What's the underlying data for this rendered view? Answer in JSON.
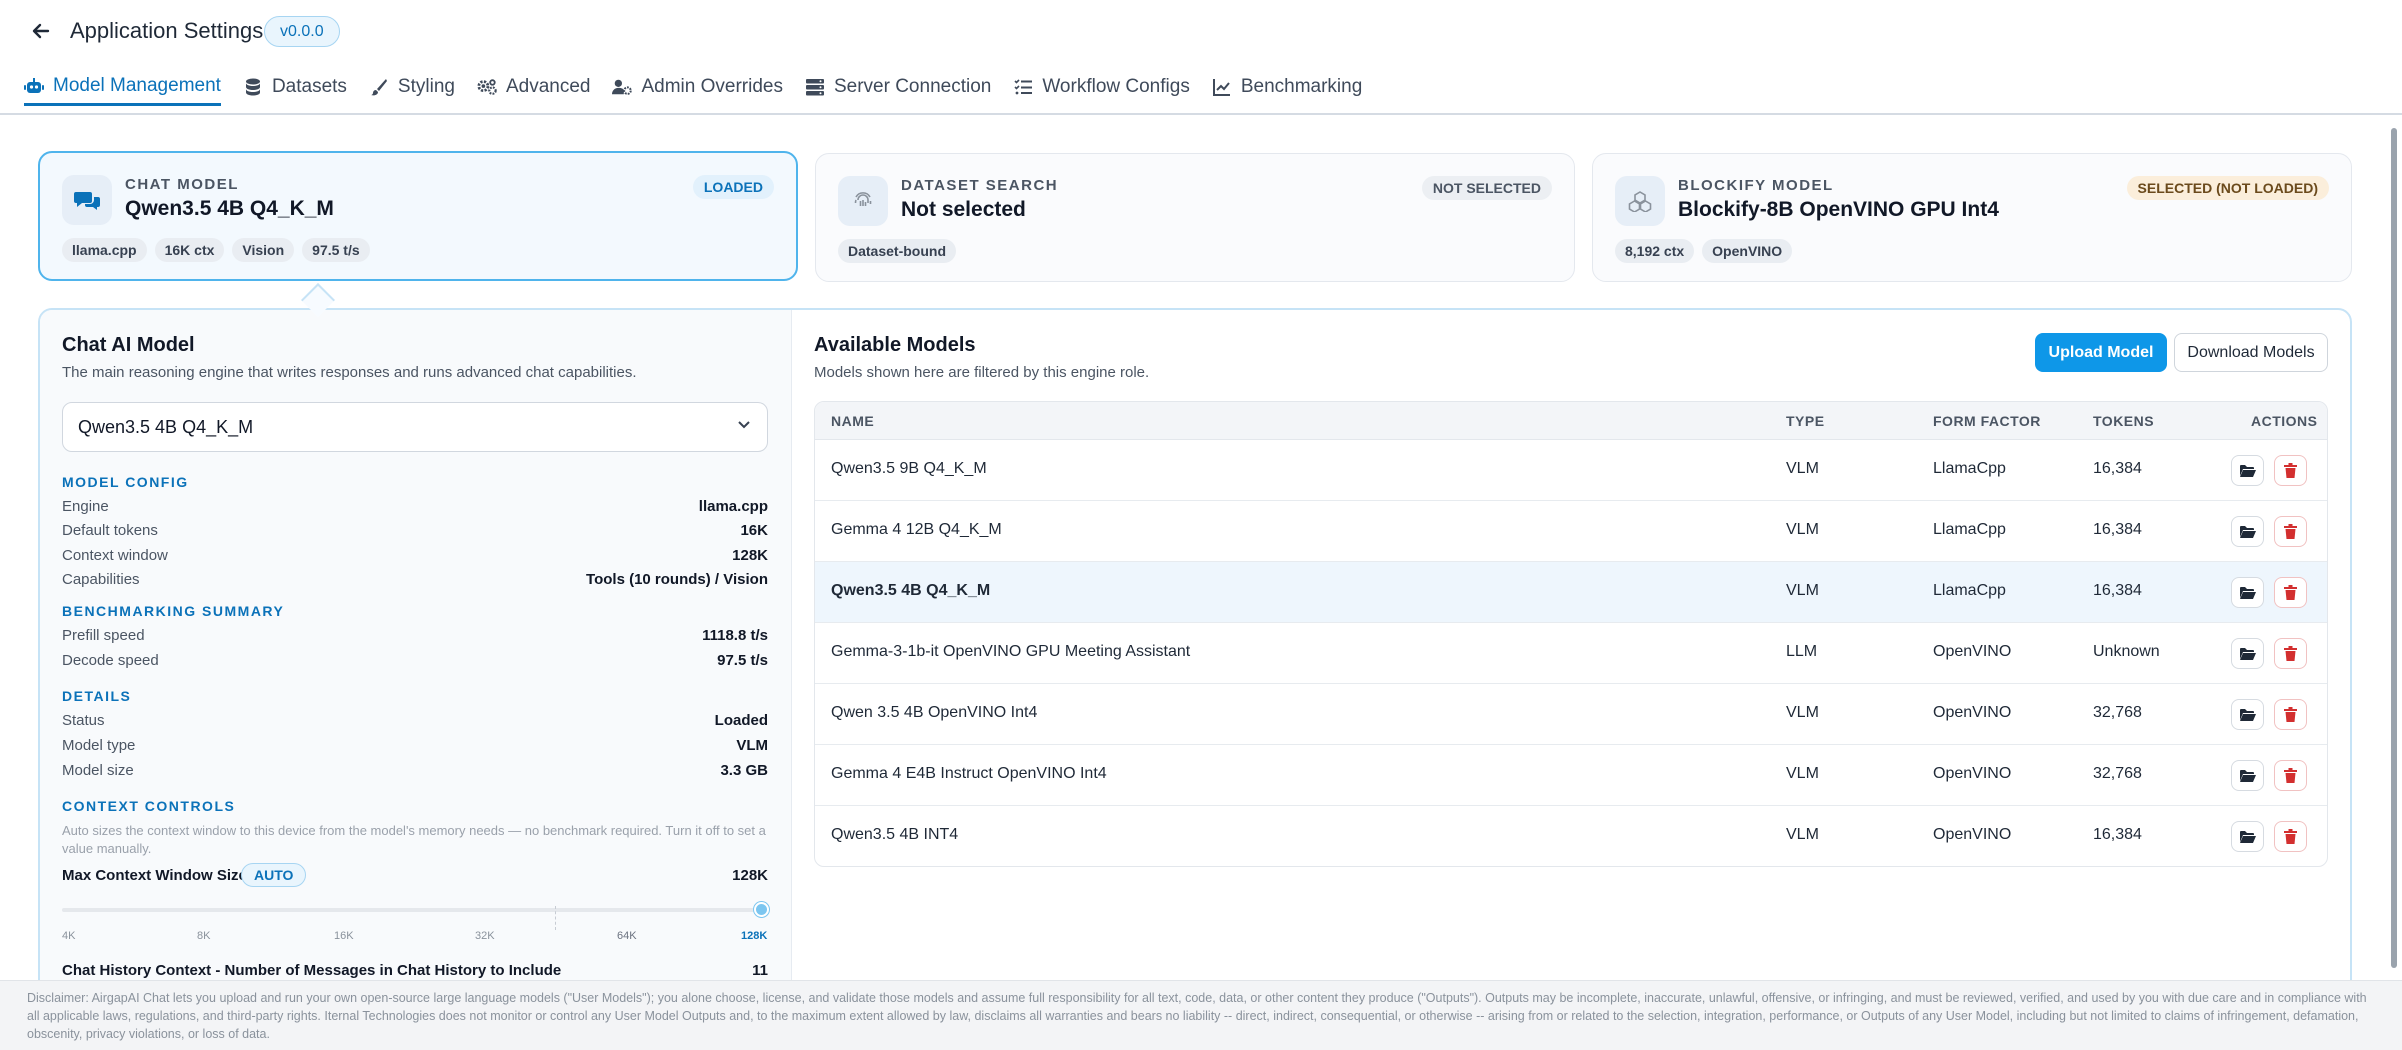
{
  "header": {
    "title": "Application Settings",
    "version": "v0.0.0",
    "tabs": [
      {
        "label": "Model Management",
        "icon": "robot-icon",
        "active": true
      },
      {
        "label": "Datasets",
        "icon": "database-icon"
      },
      {
        "label": "Styling",
        "icon": "brush-icon"
      },
      {
        "label": "Advanced",
        "icon": "gears-icon"
      },
      {
        "label": "Admin Overrides",
        "icon": "user-gear-icon"
      },
      {
        "label": "Server Connection",
        "icon": "server-icon"
      },
      {
        "label": "Workflow Configs",
        "icon": "list-check-icon"
      },
      {
        "label": "Benchmarking",
        "icon": "chart-line-icon"
      }
    ]
  },
  "cards": [
    {
      "kind": "CHAT MODEL",
      "name": "Qwen3.5 4B Q4_K_M",
      "badge": "LOADED",
      "chips": [
        "llama.cpp",
        "16K ctx",
        "Vision",
        "97.5 t/s"
      ],
      "icon": "chat-bubbles-icon"
    },
    {
      "kind": "DATASET SEARCH",
      "name": "Not selected",
      "badge": "NOT SELECTED",
      "chips": [
        "Dataset-bound"
      ],
      "icon": "fingerprint-icon"
    },
    {
      "kind": "BLOCKIFY MODEL",
      "name": "Blockify-8B OpenVINO GPU Int4",
      "badge": "SELECTED (NOT LOADED)",
      "chips": [
        "8,192 ctx",
        "OpenVINO"
      ],
      "icon": "cubes-icon"
    }
  ],
  "colors": {
    "accent": "#0e97e8",
    "loaded": "#0b72b9",
    "danger": "#d32f2f",
    "warning_bg": "#fbeedb"
  },
  "left": {
    "title": "Chat AI Model",
    "description": "The main reasoning engine that writes responses and runs advanced chat capabilities.",
    "selected_model": "Qwen3.5 4B Q4_K_M",
    "model_config": {
      "heading": "MODEL CONFIG",
      "rows": [
        {
          "k": "Engine",
          "v": "llama.cpp"
        },
        {
          "k": "Default tokens",
          "v": "16K"
        },
        {
          "k": "Context window",
          "v": "128K"
        },
        {
          "k": "Capabilities",
          "v": "Tools (10 rounds) / Vision"
        }
      ]
    },
    "bench": {
      "heading": "BENCHMARKING SUMMARY",
      "rows": [
        {
          "k": "Prefill speed",
          "v": "1118.8 t/s"
        },
        {
          "k": "Decode speed",
          "v": "97.5 t/s"
        }
      ]
    },
    "details": {
      "heading": "DETAILS",
      "rows": [
        {
          "k": "Status",
          "v": "Loaded"
        },
        {
          "k": "Model type",
          "v": "VLM"
        },
        {
          "k": "Model size",
          "v": "3.3 GB"
        }
      ]
    },
    "context": {
      "heading": "CONTEXT CONTROLS",
      "note": "Auto sizes the context window to this device from the model's memory needs — no benchmark required. Turn it off to set a value manually.",
      "label": "Max Context Window Size",
      "auto": "AUTO",
      "value": "128K",
      "ticks": [
        "4K",
        "8K",
        "16K",
        "32K",
        "64K",
        "128K"
      ],
      "slider_fraction": 1.0,
      "history_label": "Chat History Context - Number of Messages in Chat History to Include",
      "history_value": "11"
    }
  },
  "right": {
    "title": "Available Models",
    "description": "Models shown here are filtered by this engine role.",
    "upload": "Upload Model",
    "download": "Download Models",
    "columns": {
      "name": "NAME",
      "type": "TYPE",
      "form": "FORM FACTOR",
      "tokens": "TOKENS",
      "actions": "ACTIONS"
    },
    "rows": [
      {
        "name": "Qwen3.5 9B Q4_K_M",
        "type": "VLM",
        "form": "LlamaCpp",
        "tokens": "16,384"
      },
      {
        "name": "Gemma 4 12B Q4_K_M",
        "type": "VLM",
        "form": "LlamaCpp",
        "tokens": "16,384"
      },
      {
        "name": "Qwen3.5 4B Q4_K_M",
        "type": "VLM",
        "form": "LlamaCpp",
        "tokens": "16,384",
        "selected": true
      },
      {
        "name": "Gemma-3-1b-it OpenVINO GPU Meeting Assistant",
        "type": "LLM",
        "form": "OpenVINO",
        "tokens": "Unknown"
      },
      {
        "name": "Qwen 3.5 4B OpenVINO Int4",
        "type": "VLM",
        "form": "OpenVINO",
        "tokens": "32,768"
      },
      {
        "name": "Gemma 4 E4B Instruct OpenVINO Int4",
        "type": "VLM",
        "form": "OpenVINO",
        "tokens": "32,768"
      },
      {
        "name": "Qwen3.5 4B INT4",
        "type": "VLM",
        "form": "OpenVINO",
        "tokens": "16,384"
      }
    ]
  },
  "footer": {
    "disclaimer": "Disclaimer: AirgapAI Chat lets you upload and run your own open-source large language models (\"User Models\"); you alone choose, license, and validate those models and assume full responsibility for all text, code, data, or other content they produce (\"Outputs\"). Outputs may be incomplete, inaccurate, unlawful, offensive, or infringing, and must be reviewed, verified, and used by you with due care and in compliance with all applicable laws, regulations, and third-party rights. Iternal Technologies does not monitor or control any User Model Outputs and, to the maximum extent allowed by law, disclaims all warranties and bears no liability -- direct, indirect, consequential, or otherwise -- arising from or related to the selection, integration, performance, or Outputs of any User Model, including but not limited to claims of infringement, defamation, obscenity, privacy violations, or loss of data."
  }
}
